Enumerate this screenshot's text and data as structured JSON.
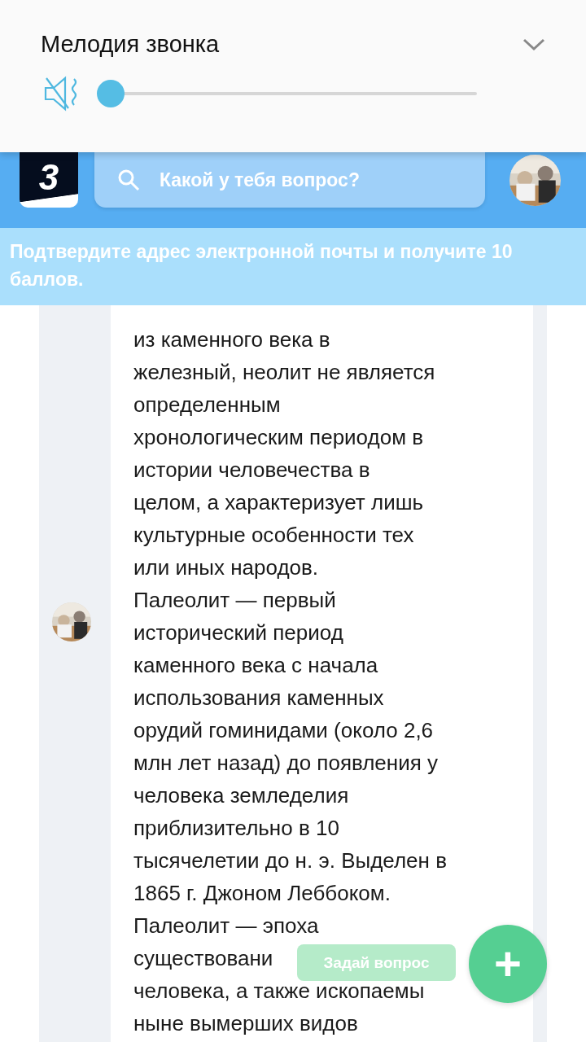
{
  "volume_panel": {
    "title": "Мелодия звонка",
    "muted": true,
    "level": 0.0
  },
  "header": {
    "logo": "3",
    "search": {
      "placeholder": "Какой у тебя вопрос?"
    }
  },
  "banner": "Подтвердите адрес электронной почты и получите 10 баллов.",
  "answer_lines": [
    "из каменного века в",
    "железный, неолит не является",
    "определенным",
    "хронологическим периодом в",
    "истории человечества в",
    "целом, а характеризует лишь",
    "культурные особенности тех",
    "или иных народов.",
    "Палеолит — первый",
    "исторический период",
    "каменного века с начала",
    "использования каменных",
    "орудий гоминидами (около 2,6",
    "млн лет назад) до появления у",
    "человека земледелия",
    "приблизительно в 10",
    "тысячелетии до н. э. Выделен в",
    "1865 г. Джоном Леббоком.",
    "Палеолит — эпоха",
    "существовани",
    "человека, а также ископаемы",
    "ныне вымерших видов"
  ],
  "ask_button": {
    "label": "Задай вопрос",
    "plus": "+"
  }
}
